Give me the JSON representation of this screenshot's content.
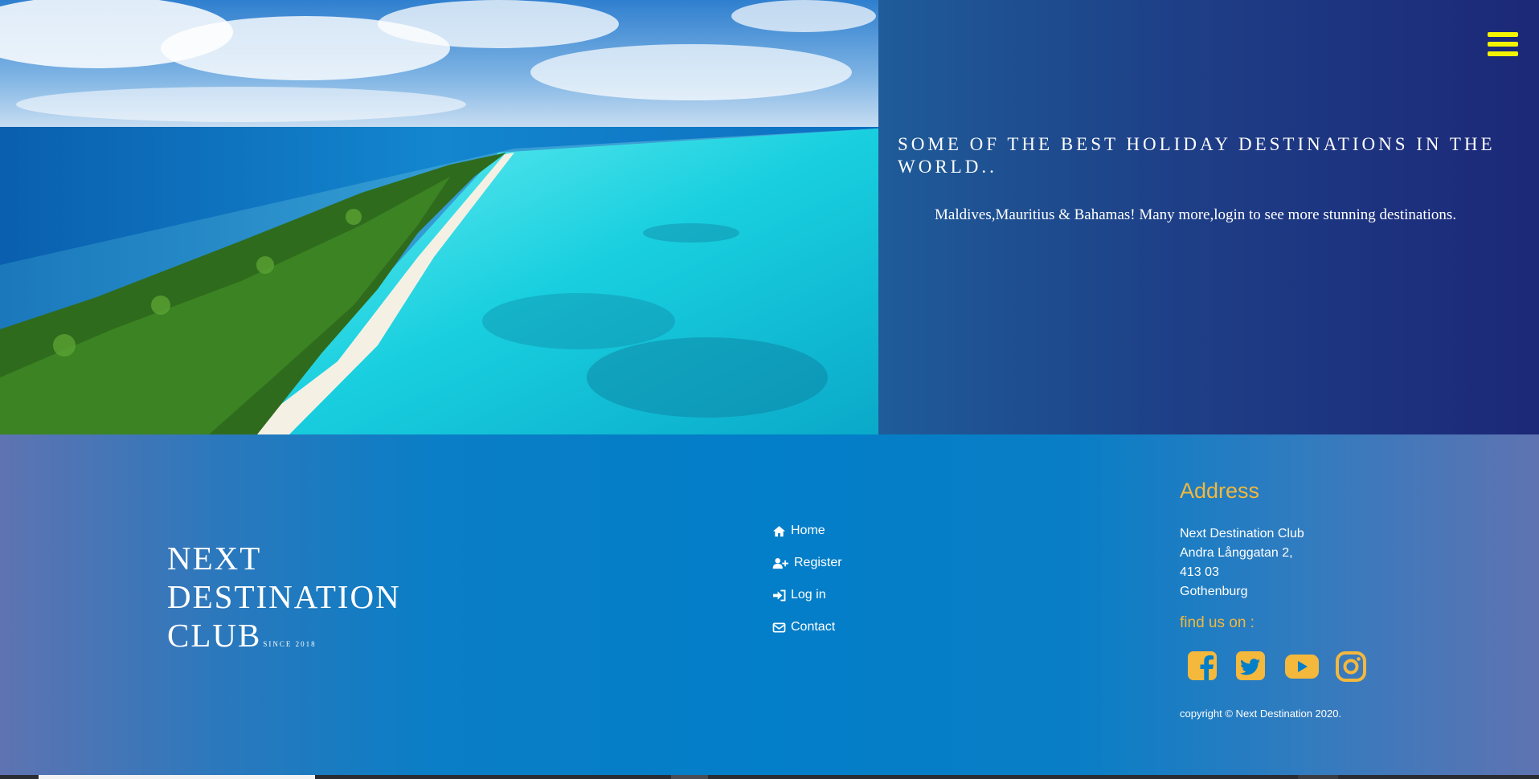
{
  "hero": {
    "title": "SOME OF THE BEST HOLIDAY DESTINATIONS IN THE WORLD..",
    "text": "Maldives,Mauritius & Bahamas! Many more,login to see more stunning destinations."
  },
  "brand": {
    "name_line1": "NEXT",
    "name_line2": "DESTINATION",
    "name_line3": "CLUB",
    "since": "SINCE 2018"
  },
  "nav": {
    "items": [
      {
        "label": "Home",
        "icon": "home-icon"
      },
      {
        "label": "Register",
        "icon": "user-plus-icon"
      },
      {
        "label": "Log in",
        "icon": "sign-in-icon"
      },
      {
        "label": "Contact",
        "icon": "envelope-icon"
      }
    ]
  },
  "address": {
    "heading": "Address",
    "lines": [
      "Next Destination Club",
      "Andra Långgatan 2,",
      "413 03",
      "Gothenburg"
    ],
    "find_us": "find us on :",
    "social": [
      "facebook-icon",
      "twitter-icon",
      "youtube-icon",
      "instagram-icon"
    ],
    "copyright": "copyright © Next Destination 2020."
  },
  "colors": {
    "accent_yellow": "#f4f400",
    "accent_orange": "#f3b83c",
    "footer_blue": "#037ec8",
    "panel_navy": "#1c2878"
  }
}
